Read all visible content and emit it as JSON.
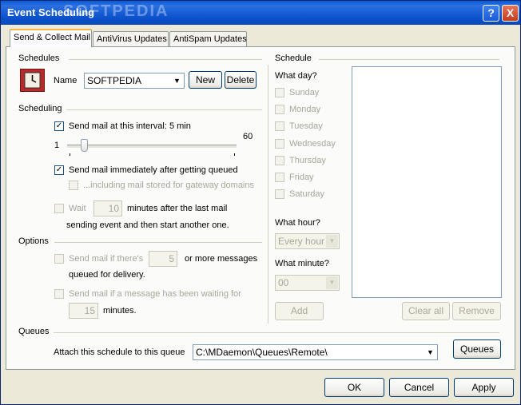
{
  "window": {
    "title": "Event Scheduling",
    "help": "?",
    "close": "X"
  },
  "tabs": [
    "Send & Collect Mail",
    "AntiVirus Updates",
    "AntiSpam Updates"
  ],
  "schedules": {
    "section": "Schedules",
    "name_label": "Name",
    "name_value": "SOFTPEDIA",
    "new_btn": "New",
    "delete_btn": "Delete"
  },
  "scheduling": {
    "section": "Scheduling",
    "interval_label": "Send mail at this interval: 5 min",
    "slider_min": "1",
    "slider_max": "60",
    "slider_value": 5,
    "immediate_label": "Send mail immediately after getting queued",
    "gateway_label": "...including mail stored for gateway domains",
    "wait_label": "Wait",
    "wait_value": "10",
    "wait_suffix": "minutes after the last mail",
    "wait_suffix2": "sending event and then start another one."
  },
  "options": {
    "section": "Options",
    "count_label": "Send mail if there's",
    "count_value": "5",
    "count_suffix": "or more messages",
    "count_suffix2": "queued for delivery.",
    "waiting_label": "Send mail if a message has been waiting for",
    "waiting_value": "15",
    "waiting_suffix": "minutes."
  },
  "schedule": {
    "section": "Schedule",
    "what_day": "What day?",
    "days": [
      "Sunday",
      "Monday",
      "Tuesday",
      "Wednesday",
      "Thursday",
      "Friday",
      "Saturday"
    ],
    "what_hour": "What hour?",
    "hour_value": "Every hour",
    "what_minute": "What minute?",
    "minute_value": "00",
    "add_btn": "Add",
    "clear_btn": "Clear all",
    "remove_btn": "Remove"
  },
  "queues": {
    "section": "Queues",
    "attach_label": "Attach this schedule to this queue",
    "queue_value": "C:\\MDaemon\\Queues\\Remote\\",
    "queues_btn": "Queues"
  },
  "footer": {
    "ok": "OK",
    "cancel": "Cancel",
    "apply": "Apply"
  },
  "watermark": "SOFTPEDIA"
}
